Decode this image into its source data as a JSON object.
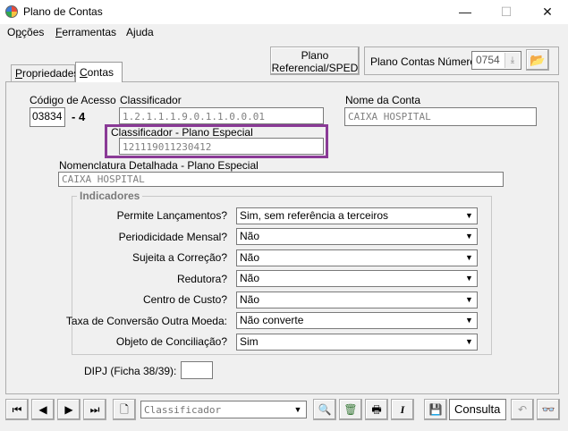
{
  "window": {
    "title": "Plano de Contas",
    "minimize": "—",
    "maximize": "☐",
    "close": "✕"
  },
  "menu": {
    "opcoes_prefix": "O",
    "opcoes_underlined": "p",
    "opcoes_suffix": "ções",
    "ferramentas_underlined": "F",
    "ferramentas_suffix": "erramentas",
    "ajuda_prefix": "A",
    "ajuda_underlined": "j",
    "ajuda_suffix": "uda"
  },
  "toolbar": {
    "plano_ref_line1": "Plano",
    "plano_ref_line2": "Referencial/SPED",
    "plano_numero_label": "Plano Contas Número",
    "plano_numero_value": "0754"
  },
  "tabs": [
    {
      "label_underlined": "P",
      "label_rest": "ropriedades"
    },
    {
      "label_underlined": "C",
      "label_rest": "ontas"
    }
  ],
  "form": {
    "codigo_acesso_label": "Código de Acesso",
    "codigo_acesso_value": "03834",
    "codigo_digit": "- 4",
    "classificador_label": "Classificador",
    "classificador_value": "1.2.1.1.1.9.0.1.1.0.0.01",
    "classif_especial_label": "Classificador  - Plano Especial",
    "classif_especial_value": "121119011230412",
    "nome_conta_label": "Nome da Conta",
    "nome_conta_value": "CAIXA HOSPITAL",
    "nomenclatura_label": "Nomenclatura Detalhada - Plano Especial",
    "nomenclatura_value": "CAIXA HOSPITAL"
  },
  "indicadores": {
    "title": "Indicadores",
    "rows": [
      {
        "label": "Permite Lançamentos?",
        "value": "Sim, sem referência a terceiros"
      },
      {
        "label": "Periodicidade Mensal?",
        "value": "Não"
      },
      {
        "label": "Sujeita a Correção?",
        "value": "Não"
      },
      {
        "label": "Redutora?",
        "value": "Não"
      },
      {
        "label": "Centro de Custo?",
        "value": "Não"
      },
      {
        "label": "Taxa de Conversão Outra Moeda:",
        "value": "Não converte"
      },
      {
        "label": "Objeto de Conciliação?",
        "value": "Sim"
      }
    ]
  },
  "dipj": {
    "label": "DIPJ (Ficha 38/39):",
    "value": ""
  },
  "bottom": {
    "search_placeholder": "Classificador",
    "mode": "Consulta"
  }
}
